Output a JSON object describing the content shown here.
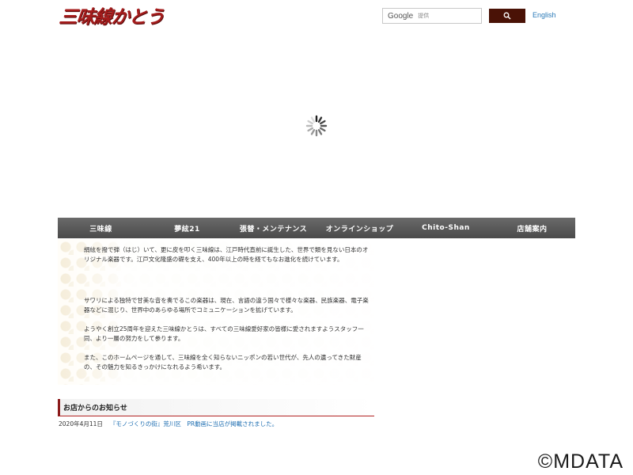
{
  "header": {
    "logo_text": "三味線かとう",
    "search": {
      "brand": "Google",
      "placeholder": "提供"
    },
    "english_link": "English"
  },
  "nav": {
    "items": [
      "三味線",
      "夢絃21",
      "張替・メンテナンス",
      "オンラインショップ",
      "Chito-Shan",
      "店舗案内"
    ]
  },
  "intro": {
    "p1": "絹絃を撥で弾（はじ）いて、更に皮を叩く三味線は、江戸時代直前に誕生した、世界で類を見ない日本のオリジナル楽器です。江戸文化隆盛の礎を支え、400年以上の時を経てもなお進化を続けています。",
    "p2": "サワリによる独特で甘美な音を奏でるこの楽器は、現在、言語の違う国々で様々な楽器、民族楽器、電子楽器などに混じり、世界中のあらゆる場所でコミュニケーションを拡げています。",
    "p3": "ようやく創立25周年を迎えた三味線かとうは、すべての三味線愛好家の皆様に愛されますようスタッフ一同、より一層の努力をして参ります。",
    "p4": "また、このホームページを通して、三味線を全く知らないニッポンの若い世代が、先人の遺ってきた財産の、その魅力を知るきっかけになれるよう希います。"
  },
  "news": {
    "heading": "お店からのお知らせ",
    "items": [
      {
        "date": "2020年4月11日",
        "text": "『モノづくりの街』荒川区　PR動画に当店が掲載されました。"
      }
    ]
  },
  "watermark": "©MDATA",
  "colors": {
    "brand_red": "#a51c1c",
    "search_button": "#4a1206",
    "link_blue": "#2a7ab8",
    "nav_bg": "#555555"
  }
}
